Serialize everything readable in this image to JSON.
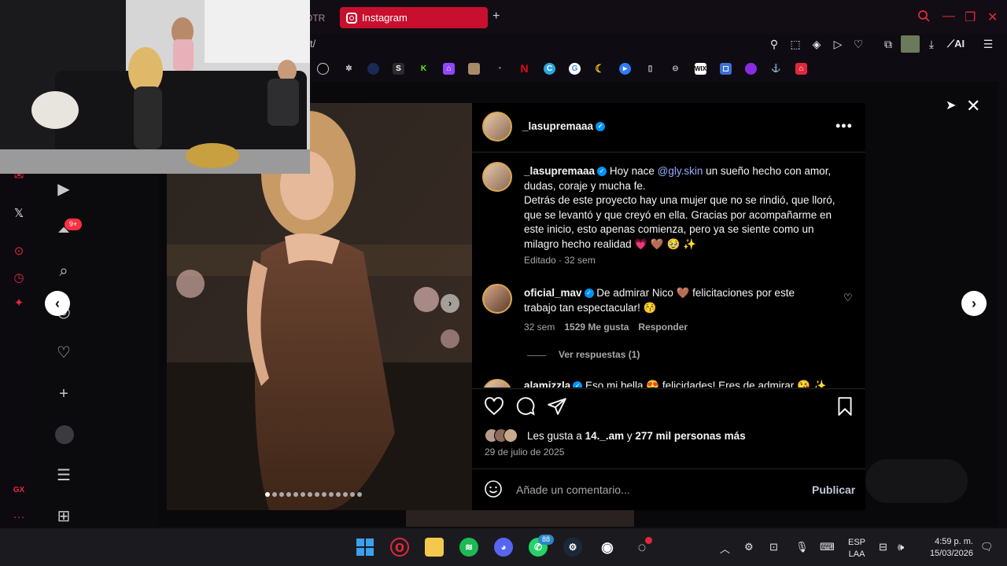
{
  "browser": {
    "tab_partial": "OTR",
    "active_tab": "Instagram",
    "url_partial": "t/",
    "toolbar_ai": "AI"
  },
  "sidebar": {
    "opera_gx_label": "GX",
    "notif_count": "9+"
  },
  "post": {
    "author": "_lasupremaaa",
    "caption_user": "_lasupremaaa",
    "caption_intro": " Hoy nace ",
    "caption_mention": "@gly.skin",
    "caption_rest": " un sueño hecho con amor, dudas, coraje y mucha fe.",
    "caption_p2": "Detrás de este proyecto hay una mujer que no se rindió, que lloró, que se levantó y que creyó en ella. Gracias por acompañarme en este inicio, esto apenas comienza, pero ya se siente como un milagro hecho realidad 💗 🤎 🥹 ✨",
    "edited_meta": "Editado · 32 sem",
    "comments": [
      {
        "user": "oficial_mav",
        "text": " De admirar Nico 🤎 felicitaciones por este trabajo tan espectacular! 😚",
        "time": "32 sem",
        "likes": "1529 Me gusta",
        "reply": "Responder",
        "view_replies": "Ver respuestas (1)"
      },
      {
        "user": "alamizzla",
        "text": " Eso mi bella 😍 felicidades! Eres de admirar 😘 ✨"
      }
    ],
    "likes_line_prefix": "Les gusta a ",
    "likes_user": "14._.am",
    "likes_line_mid": " y ",
    "likes_count": "277 mil personas más",
    "date": "29 de julio de 2025",
    "comment_placeholder": "Añade un comentario...",
    "publish_label": "Publicar"
  },
  "taskbar": {
    "whatsapp_badge": "88",
    "lang_top": "ESP",
    "lang_bottom": "LAA",
    "time": "4:59 p. m.",
    "date": "15/03/2026"
  },
  "colors": {
    "opera_red": "#e0283c",
    "ig_blue": "#0095f6",
    "mention": "#9aaefc"
  }
}
